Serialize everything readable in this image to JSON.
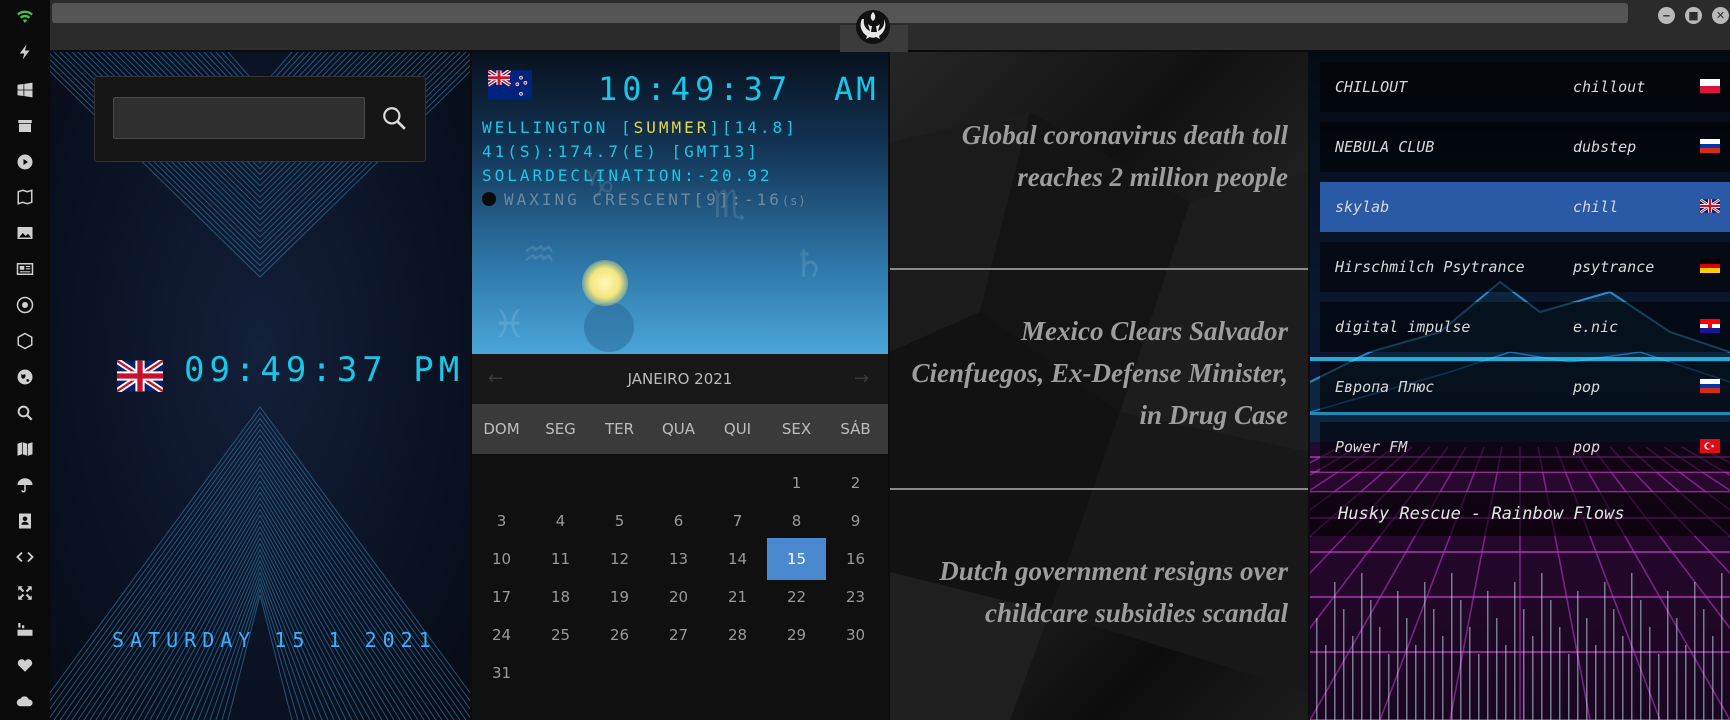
{
  "sidebar": {
    "icons": [
      "wifi-icon",
      "bolt-icon",
      "windows-icon",
      "archive-icon",
      "play-icon",
      "map-book-icon",
      "image-icon",
      "news-icon",
      "aperture-icon",
      "hexagon-icon",
      "globe-icon",
      "search-icon",
      "map-icon",
      "umbrella-icon",
      "contact-icon",
      "code-icon",
      "expand-icon",
      "youtube-icon",
      "heart-icon",
      "cloud-icon"
    ],
    "accent": "#3ecf3e"
  },
  "header": {
    "emblem": "rebel-alliance-icon",
    "window_buttons": [
      "minimize",
      "maximize",
      "close"
    ]
  },
  "panel_clock_uk": {
    "search": {
      "value": "",
      "placeholder": ""
    },
    "flag": "uk-flag",
    "time": "09:49:37 PM",
    "date": "SATURDAY 15 1 2021",
    "color": "#19c8e8"
  },
  "panel_clock_nz": {
    "flag": "nz-flag",
    "time": "10:49:37",
    "ampm": "AM",
    "line1_prefix": "WELLINGTON [",
    "line1_season": "SUMMER",
    "line1_suffix": "][14.8]",
    "line2": "41(S):174.7(E) [GMT13]",
    "line3": "SOLARDECLINATION:-20.92",
    "moon_text": "WAXING CRESCENT[9]:-16",
    "moon_unit": "(s)"
  },
  "calendar": {
    "title": "JANEIRO 2021",
    "prev": "←",
    "next": "→",
    "weekdays": [
      "DOM",
      "SEG",
      "TER",
      "QUA",
      "QUI",
      "SEX",
      "SÁB"
    ],
    "first_weekday_index": 5,
    "days_in_month": 31,
    "selected_day": 15,
    "accent": "#4a89cf"
  },
  "news": {
    "headlines": [
      "Global coronavirus death toll reaches 2 million people",
      "Mexico Clears Salvador Cienfuegos, Ex-Defense Minister, in Drug Case",
      "Dutch government resigns over childcare subsidies scandal"
    ]
  },
  "radio": {
    "stations": [
      {
        "name": "CHILLOUT",
        "genre": "chillout",
        "flag": "poland-flag",
        "selected": false
      },
      {
        "name": "NEBULA CLUB",
        "genre": "dubstep",
        "flag": "russia-flag",
        "selected": false
      },
      {
        "name": "skylab",
        "genre": "chill",
        "flag": "uk-flag",
        "selected": true
      },
      {
        "name": "Hirschmilch Psytrance",
        "genre": "psytrance",
        "flag": "germany-flag",
        "selected": false
      },
      {
        "name": "digital impulse",
        "genre": "e.nic",
        "flag": "croatia-flag",
        "selected": false
      },
      {
        "name": "Европа Плюс",
        "genre": "pop",
        "flag": "russia-flag",
        "selected": false
      },
      {
        "name": "Power FM",
        "genre": "pop",
        "flag": "turkey-flag",
        "selected": false
      }
    ],
    "now_playing": "Husky Rescue - Rainbow Flows",
    "selected_color": "#2a5aa6"
  }
}
